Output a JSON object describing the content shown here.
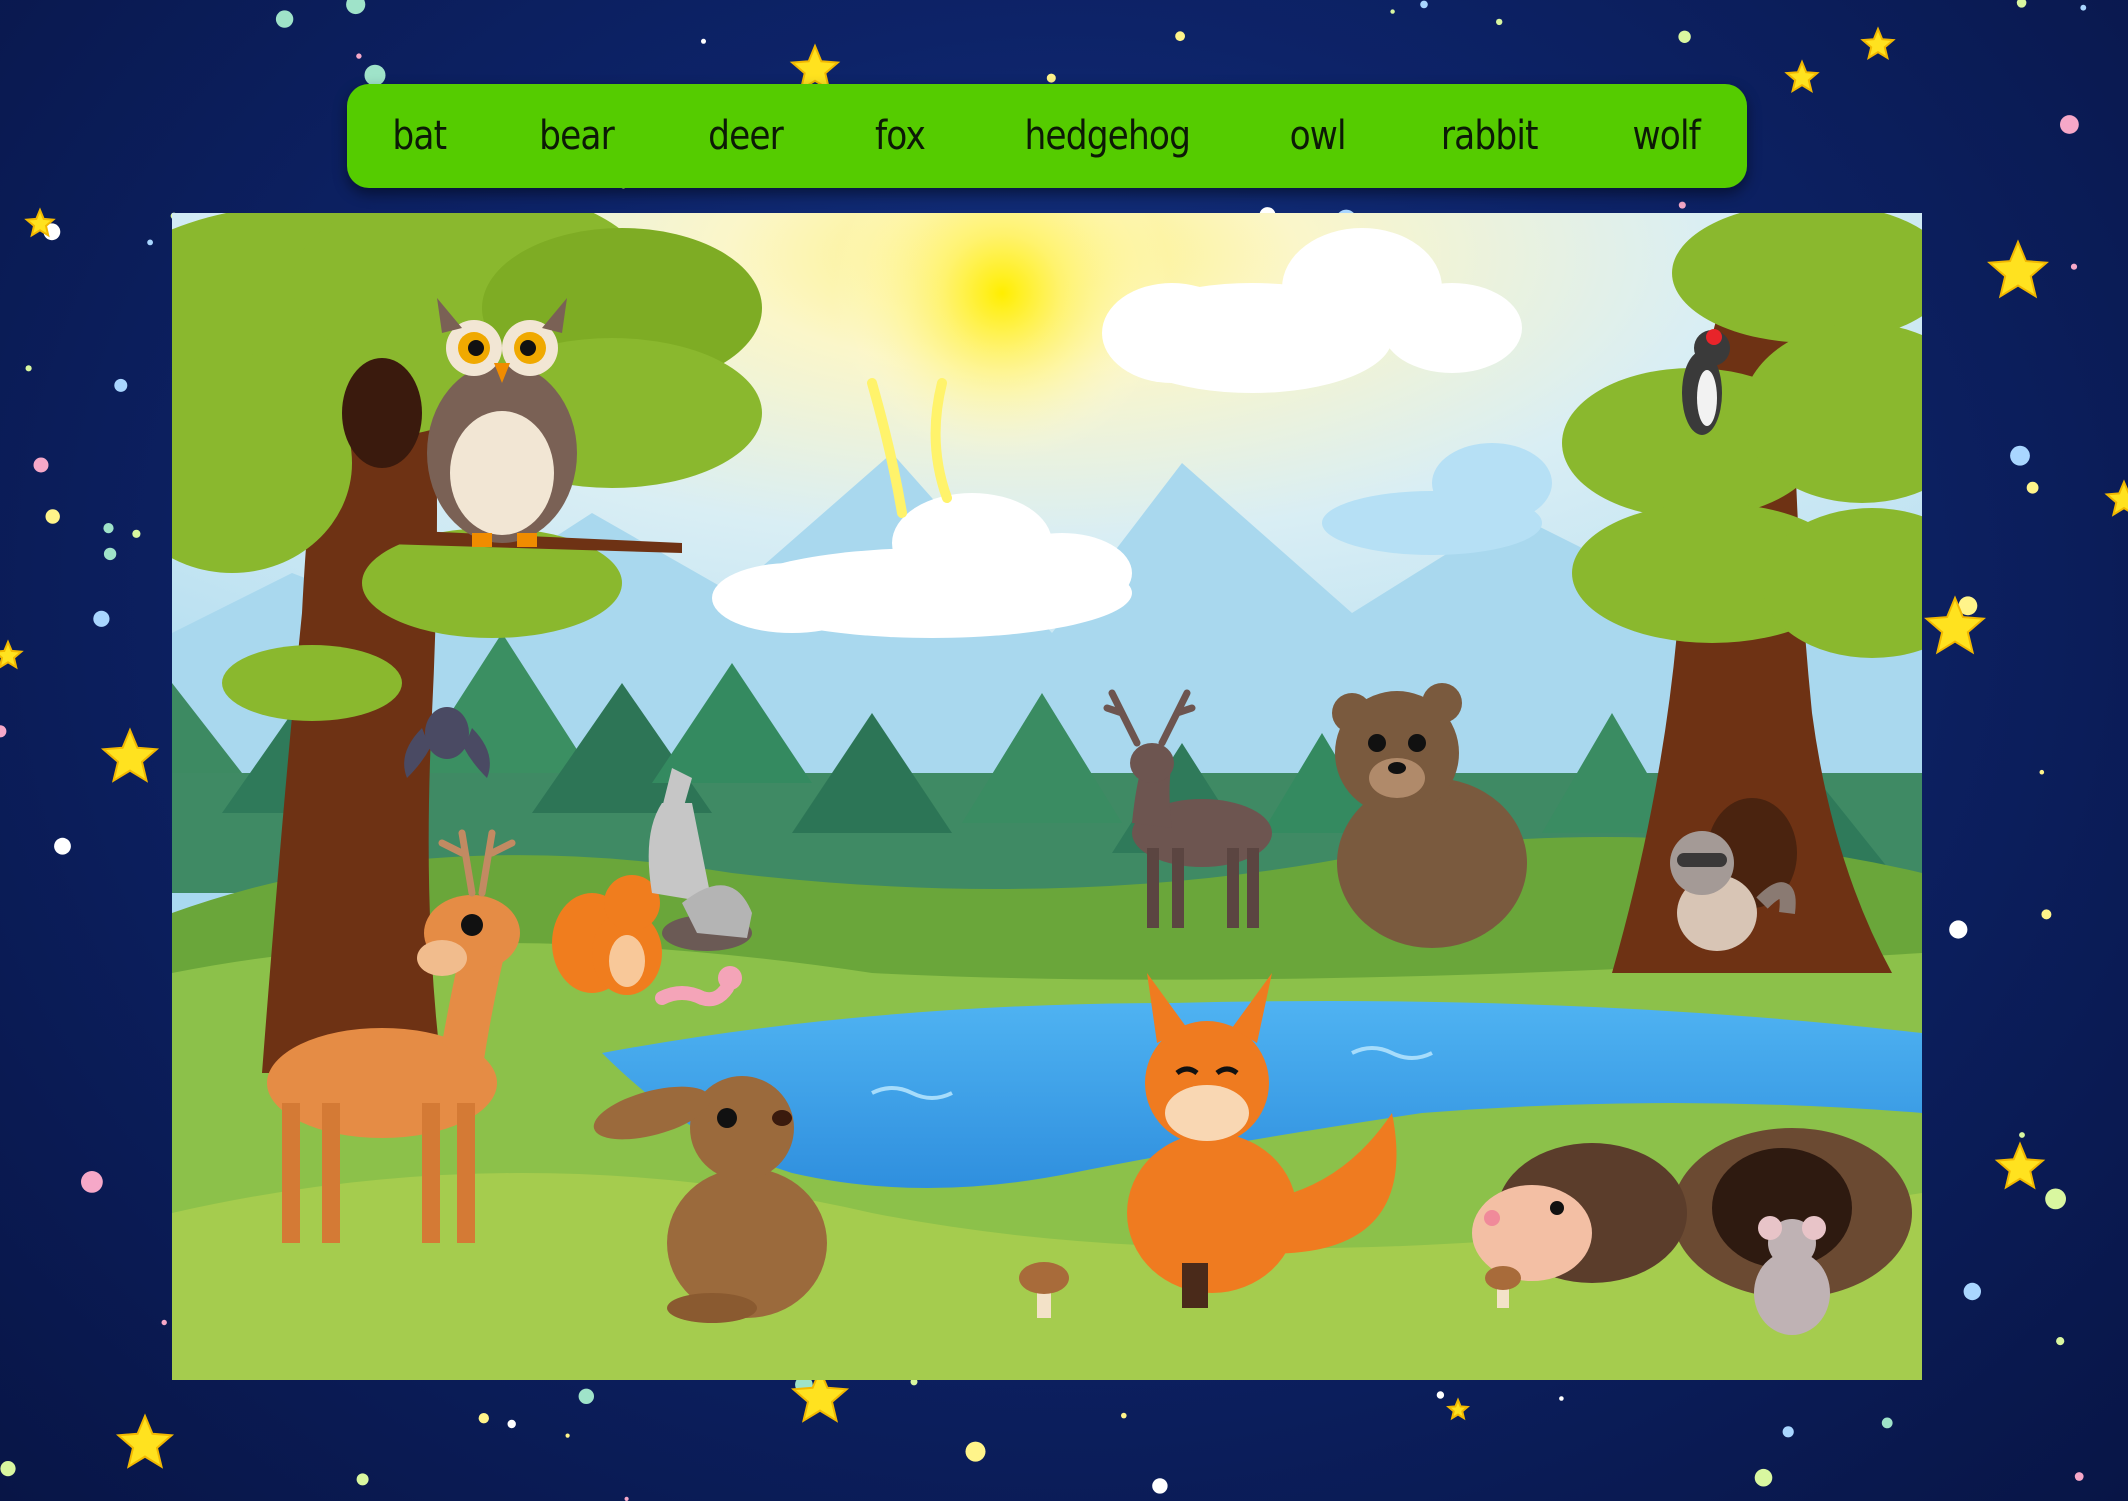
{
  "words": [
    "bat",
    "bear",
    "deer",
    "fox",
    "hedgehog",
    "owl",
    "rabbit",
    "wolf"
  ],
  "colors": {
    "background": "#0d2368",
    "word_bar": "#55cc00",
    "word_text": "#0c1a06",
    "star_yellow": "#ffe21f"
  },
  "scene": {
    "animals": [
      "owl",
      "bat",
      "deer",
      "squirrel",
      "worm",
      "wolf",
      "deer-stag",
      "bear",
      "raccoon",
      "woodpecker",
      "rabbit",
      "fox",
      "hedgehog",
      "mouse"
    ]
  }
}
